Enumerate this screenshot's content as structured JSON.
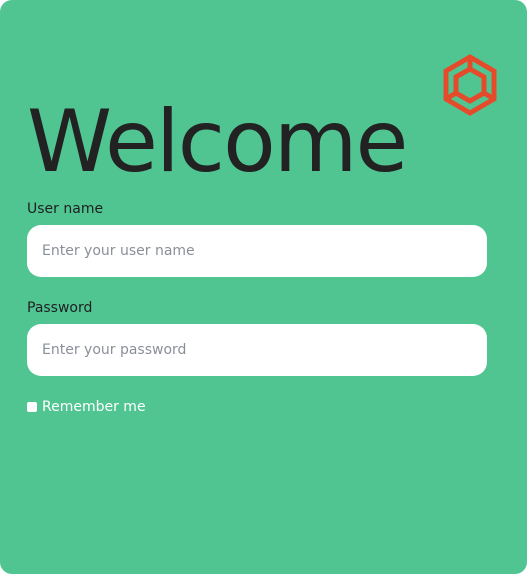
{
  "colors": {
    "background": "#50c592",
    "logo": "#e54b2a",
    "title": "#222222",
    "input_bg": "#ffffff"
  },
  "logo": {
    "icon": "hexagon-cube-logo-icon"
  },
  "heading": {
    "title": "Welcome"
  },
  "username": {
    "label": "User name",
    "placeholder": "Enter your user name",
    "value": ""
  },
  "password": {
    "label": "Password",
    "placeholder": "Enter your password",
    "value": ""
  },
  "remember": {
    "label": "Remember me",
    "checked": false
  }
}
